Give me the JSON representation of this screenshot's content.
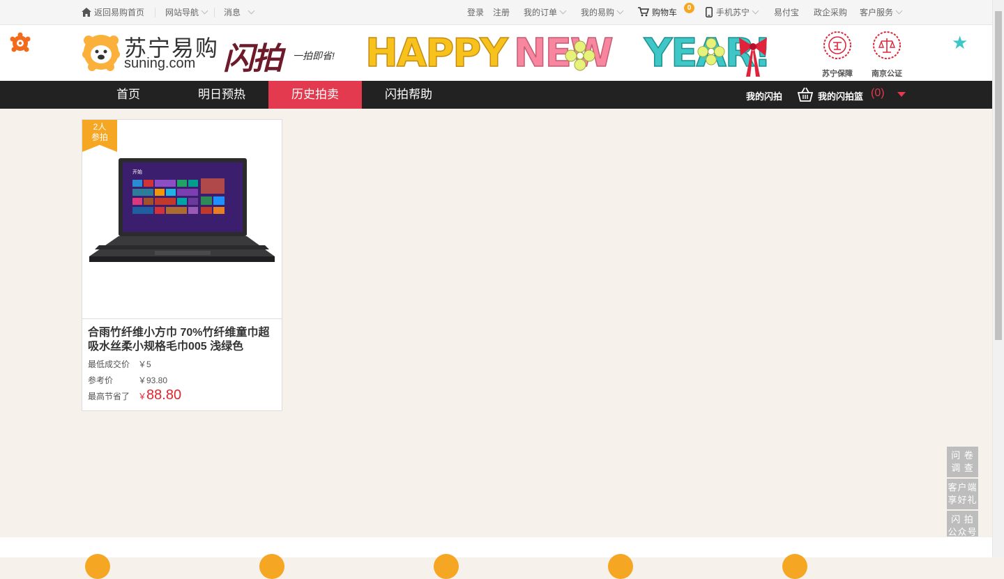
{
  "topbar": {
    "home_link": "返回易购首页",
    "site_nav": "网站导航",
    "messages": "消息",
    "login": "登录",
    "register": "注册",
    "my_orders": "我的订单",
    "my_yigou": "我的易购",
    "cart": "购物车",
    "cart_count": "0",
    "mobile": "手机苏宁",
    "yifubao": "易付宝",
    "gov_purchase": "政企采购",
    "customer_service": "客户服务"
  },
  "header": {
    "logo_cn": "苏宁易购",
    "logo_en": "suning.com",
    "flash_title": "闪拍",
    "flash_slogan": "一拍即省!",
    "banner_text": "HAPPY NEW YEAR!",
    "badge_guarantee": "苏宁保障",
    "badge_notary": "南京公证"
  },
  "nav": {
    "tabs": [
      "首页",
      "明日预热",
      "历史拍卖",
      "闪拍帮助"
    ],
    "active_tab": "历史拍卖",
    "my_flash": "我的闪拍",
    "basket_label": "我的闪拍篮",
    "basket_count": "(0)"
  },
  "product": {
    "participants_line1": "2人",
    "participants_line2": "参拍",
    "title": "合雨竹纤维小方巾 70%竹纤维童巾超吸水丝柔小规格毛巾005 浅绿色",
    "lowest_price_label": "最低成交价",
    "lowest_price": "￥5",
    "reference_label": "参考价",
    "reference_price": "￥93.80",
    "saved_label": "最高节省了",
    "saved_currency": "￥",
    "saved_amount": "88.80"
  },
  "float_tools": {
    "survey": "问 卷 调 查",
    "app": "客户端 享好礼",
    "wechat": "闪 拍 公众号"
  },
  "colors": {
    "accent_red": "#e33a4f",
    "nav_bg": "#222222",
    "page_bg": "#f6f1ea",
    "ribbon_orange": "#f5a623",
    "price_red": "#e4222e"
  }
}
